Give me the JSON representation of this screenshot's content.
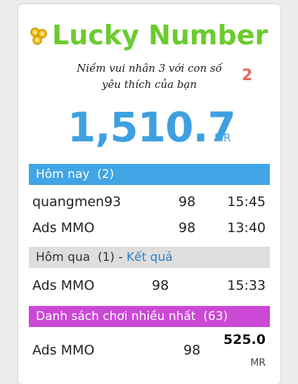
{
  "header": {
    "title": "Lucky Number",
    "subtitle_line1": "Niềm vui nhân 3 với con số",
    "subtitle_line2": "yêu thích của bạn",
    "badge": "2"
  },
  "jackpot": {
    "value": "1,510.7",
    "unit": "MR"
  },
  "today": {
    "label": "Hôm nay",
    "count": "(2)",
    "rows": [
      {
        "name": "quangmen93",
        "number": "98",
        "time": "15:45"
      },
      {
        "name": "Ads MMO",
        "number": "98",
        "time": "13:40"
      }
    ]
  },
  "yesterday": {
    "label": "Hôm qua",
    "count": "(1)",
    "sep": "-",
    "link": "Kết quả",
    "rows": [
      {
        "name": "Ads MMO",
        "number": "98",
        "time": "15:33"
      }
    ]
  },
  "top_players": {
    "label": "Danh sách chơi nhiều nhất",
    "count": "(63)",
    "rows": [
      {
        "name": "Ads MMO",
        "number": "98",
        "amount": "525.0",
        "unit": "MR"
      }
    ]
  },
  "colors": {
    "logo": "#6ccb2e",
    "jackpot": "#3ea0e0",
    "today_bar": "#41a5e6",
    "yesterday_bar": "#dedede",
    "top_bar": "#cc48d6",
    "link": "#2f7fc1"
  }
}
